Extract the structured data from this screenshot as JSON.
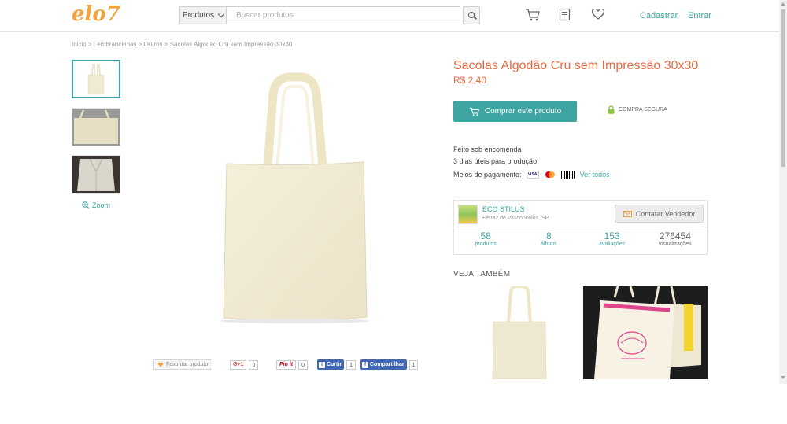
{
  "header": {
    "logo": "elo7",
    "search_category": "Produtos",
    "search_placeholder": "Buscar produtos",
    "icons": [
      "cart-icon",
      "list-icon",
      "heart-icon"
    ],
    "register": "Cadastrar",
    "login": "Entrar"
  },
  "breadcrumb": "Inicio > Lembrancinhas > Outros > Sacolas Algodão Cru sem Impressão 30x30",
  "gallery": {
    "zoom": "Zoom",
    "thumbnail_count": 3
  },
  "product": {
    "title": "Sacolas Algodão Cru sem Impressão 30x30",
    "price": "R$ 2,40",
    "buy_label": "Comprar este produto",
    "secure_label": "COMPRA SEGURA",
    "made_to_order": "Feito sob encomenda",
    "production_time": "3 dias úteis para produção",
    "payment_label": "Meios de pagamento:",
    "payment_cards": [
      "VISA",
      "mastercard",
      "BOLETO"
    ],
    "see_all": "Ver todos"
  },
  "seller": {
    "name": "ECO STILUS",
    "location": "Ferraz de Vasconcelos, SP",
    "contact_label": "Contatar Vendedor",
    "stats": [
      {
        "value": "58",
        "label": "produtos"
      },
      {
        "value": "8",
        "label": "álbuns"
      },
      {
        "value": "153",
        "label": "avaliações"
      },
      {
        "value": "276454",
        "label": "visualizações"
      }
    ]
  },
  "see_also": "VEJA TAMBÉM",
  "social": {
    "favorite": "Favoritar produto",
    "gplus": "G+1",
    "gplus_count": "0",
    "pinit": "Pin it",
    "pinit_count": "0",
    "fb_like": "Curtir",
    "fb_like_count": "1",
    "fb_share": "Compartilhar",
    "fb_share_count": "1"
  },
  "colors": {
    "brand_orange": "#f3a33b",
    "teal": "#3ea5a2",
    "title_orange": "#e8693e"
  }
}
